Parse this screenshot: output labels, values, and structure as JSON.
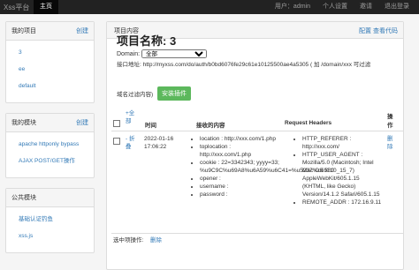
{
  "topbar": {
    "brand": "Xss平台",
    "home": "主页",
    "user": "用户：admin",
    "settings": "个人设置",
    "invite": "邀请",
    "logout": "退出登录"
  },
  "sidebar": {
    "projects": {
      "title": "我的项目",
      "action": "创建",
      "items": [
        "3",
        "ee",
        "default"
      ]
    },
    "modules": {
      "title": "我的模块",
      "action": "创建",
      "items": [
        "apache httponly bypass",
        "AJAX POST/GET操作"
      ]
    },
    "public_modules": {
      "title": "公共模块",
      "items": [
        "基础认证钓鱼",
        "xss.js"
      ]
    }
  },
  "main": {
    "panel_title": "项目内容",
    "config_label": "配置",
    "view_code_label": "查看代码",
    "project_title": "项目名称: 3",
    "domain_label": "Domain:",
    "domain_value": "全部",
    "interface_text": "接口地址: http://myxss.com/do/auth/b0bd6076fe29c61e10125500ae4a5305 ( 加 /domain/xxx 可过滤",
    "interface_text2": "域名过滤内容)",
    "install_button": "安装插件",
    "table": {
      "select_all": "+全部",
      "col_time": "时间",
      "col_content": "接收的内容",
      "col_headers": "Request Headers",
      "col_ops": "操作",
      "rows": [
        {
          "expand": "- 折叠",
          "time": "2022-01-16 17:06:22",
          "content": [
            "location : http://xxx.com/1.php",
            "toplocation : http://xxx.com/1.php",
            "cookie : 22=3342343; yyyy=33; %u9C9C%u69A8%u6A59%u6C41=%u5237%u65B0",
            "opener :",
            "username :",
            "password :"
          ],
          "headers": [
            "HTTP_REFERER : http://xxx.com/",
            "HTTP_USER_AGENT : Mozilla/5.0 (Macintosh; Intel Mac OS X 10_15_7) AppleWebKit/605.1.15 (KHTML, like Gecko) Version/14.1.2 Safari/605.1.15",
            "REMOTE_ADDR : 172.16.9.11"
          ],
          "delete": "删除"
        }
      ],
      "footer_label": "选中项操作:",
      "footer_delete": "删除"
    }
  }
}
